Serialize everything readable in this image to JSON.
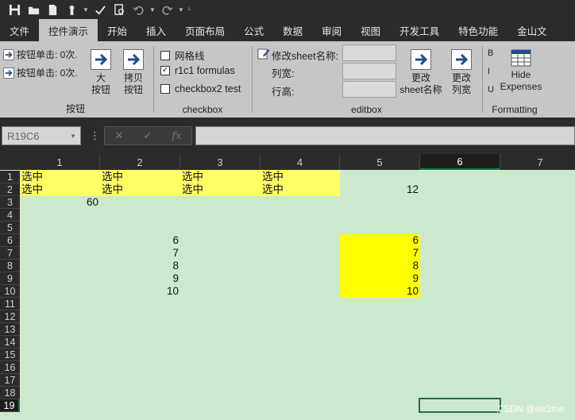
{
  "tabs": [
    "文件",
    "控件演示",
    "开始",
    "插入",
    "页面布局",
    "公式",
    "数据",
    "审阅",
    "视图",
    "开发工具",
    "特色功能",
    "金山文"
  ],
  "ribbon": {
    "buttons_group": {
      "label": "按钮",
      "small1": "按钮单击: 0次.",
      "small2": "按钮单击: 0次.",
      "big1_line1": "大",
      "big1_line2": "按钮",
      "big2_line1": "拷贝",
      "big2_line2": "按钮"
    },
    "checkbox_group": {
      "label": "checkbox",
      "cb1": "网格线",
      "cb1_checked": "",
      "cb2": "r1c1 formulas",
      "cb2_checked": "✓",
      "cb3": "checkbox2 test",
      "cb3_checked": ""
    },
    "editbox_group": {
      "label": "editbox",
      "rename_label": "修改sheet名称:",
      "colwidth_label": "列宽:",
      "rowheight_label": "行高:",
      "rename_btn_line1": "更改",
      "rename_btn_line2": "sheet名称",
      "colwidth_btn_line1": "更改",
      "colwidth_btn_line2": "列宽"
    },
    "formatting_group": {
      "label": "Formatting",
      "bold": "B",
      "italic": "I",
      "underline": "U",
      "hide_line1": "Hide",
      "hide_line2": "Expenses"
    }
  },
  "formula_bar": {
    "name_box": "R19C6",
    "cancel": "✕",
    "enter": "✓",
    "fx": "fx",
    "dots": "⋮"
  },
  "grid": {
    "columns": [
      "1",
      "2",
      "3",
      "4",
      "5",
      "6",
      "7"
    ],
    "rows": [
      "1",
      "2",
      "3",
      "4",
      "5",
      "6",
      "7",
      "8",
      "9",
      "10",
      "11",
      "12",
      "13",
      "14",
      "15",
      "16",
      "17",
      "18",
      "19"
    ],
    "selected_column": "6",
    "selected_row": "19",
    "cells": {
      "r1c1": "选中",
      "r1c2": "选中",
      "r1c3": "选中",
      "r1c4": "选中",
      "r2c1": "选中",
      "r2c2": "选中",
      "r2c3": "选中",
      "r2c4": "选中",
      "r2c5": "12",
      "r3c1": "60",
      "r6c3": "6",
      "r7c3": "7",
      "r8c3": "8",
      "r9c3": "9",
      "r10c3": "10",
      "r6c5": "6",
      "r7c5": "7",
      "r8c5": "8",
      "r9c5": "9",
      "r10c5": "10"
    }
  },
  "watermark": "CSDN @six2me",
  "colors": {
    "sheet_background": "#cde9cd",
    "highlight_lemon": "#ffff66",
    "highlight_yellow": "#ffff00",
    "ribbon_background": "#c6c6c6",
    "dark_chrome": "#2b2b2b",
    "selection_green": "#217346"
  }
}
